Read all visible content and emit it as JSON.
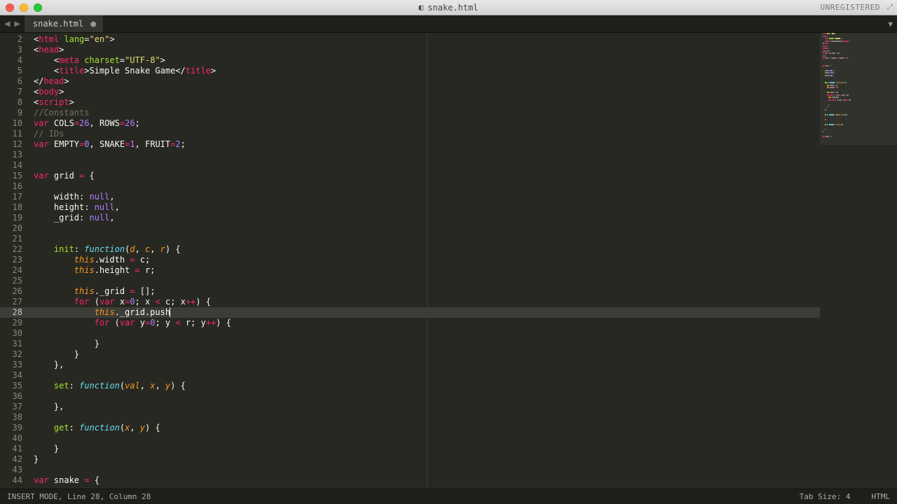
{
  "window": {
    "title": "snake.html",
    "unregistered": "UNREGISTERED"
  },
  "tabs": [
    {
      "label": "snake.html",
      "dirty": true
    }
  ],
  "gutter_start": 2,
  "gutter_end": 44,
  "active_line": 28,
  "status": {
    "left": "INSERT MODE, Line 28, Column 28",
    "tab_size": "Tab Size: 4",
    "syntax": "HTML"
  },
  "code_lines": [
    {
      "n": 2,
      "seg": [
        [
          "punc",
          "<"
        ],
        [
          "tag",
          "html"
        ],
        [
          "punc",
          " "
        ],
        [
          "attr",
          "lang"
        ],
        [
          "punc",
          "="
        ],
        [
          "str",
          "\"en\""
        ],
        [
          "punc",
          ">"
        ]
      ]
    },
    {
      "n": 3,
      "seg": [
        [
          "punc",
          "<"
        ],
        [
          "tag",
          "head"
        ],
        [
          "punc",
          ">"
        ]
      ]
    },
    {
      "n": 4,
      "seg": [
        [
          "punc",
          "    <"
        ],
        [
          "tag",
          "meta"
        ],
        [
          "punc",
          " "
        ],
        [
          "attr",
          "charset"
        ],
        [
          "punc",
          "="
        ],
        [
          "str",
          "\"UTF-8\""
        ],
        [
          "punc",
          ">"
        ]
      ]
    },
    {
      "n": 5,
      "seg": [
        [
          "punc",
          "    <"
        ],
        [
          "tag",
          "title"
        ],
        [
          "punc",
          ">"
        ],
        [
          "punc",
          "Simple Snake Game"
        ],
        [
          "punc",
          "</"
        ],
        [
          "tag",
          "title"
        ],
        [
          "punc",
          ">"
        ]
      ]
    },
    {
      "n": 6,
      "seg": [
        [
          "punc",
          "</"
        ],
        [
          "tag",
          "head"
        ],
        [
          "punc",
          ">"
        ]
      ]
    },
    {
      "n": 7,
      "seg": [
        [
          "punc",
          "<"
        ],
        [
          "tag",
          "body"
        ],
        [
          "punc",
          ">"
        ]
      ]
    },
    {
      "n": 8,
      "seg": [
        [
          "punc",
          "<"
        ],
        [
          "tag",
          "script"
        ],
        [
          "punc",
          ">"
        ]
      ]
    },
    {
      "n": 9,
      "seg": [
        [
          "cmt",
          "//Constants"
        ]
      ]
    },
    {
      "n": 10,
      "seg": [
        [
          "kw",
          "var"
        ],
        [
          "punc",
          " COLS"
        ],
        [
          "kw",
          "="
        ],
        [
          "num",
          "26"
        ],
        [
          "punc",
          ", ROWS"
        ],
        [
          "kw",
          "="
        ],
        [
          "num",
          "26"
        ],
        [
          "punc",
          ";"
        ]
      ]
    },
    {
      "n": 11,
      "seg": [
        [
          "cmt",
          "// IDs"
        ]
      ]
    },
    {
      "n": 12,
      "seg": [
        [
          "kw",
          "var"
        ],
        [
          "punc",
          " EMPTY"
        ],
        [
          "kw",
          "="
        ],
        [
          "num",
          "0"
        ],
        [
          "punc",
          ", SNAKE"
        ],
        [
          "kw",
          "="
        ],
        [
          "num",
          "1"
        ],
        [
          "punc",
          ", FRUIT"
        ],
        [
          "kw",
          "="
        ],
        [
          "num",
          "2"
        ],
        [
          "punc",
          ";"
        ]
      ]
    },
    {
      "n": 13,
      "seg": []
    },
    {
      "n": 14,
      "seg": []
    },
    {
      "n": 15,
      "seg": [
        [
          "kw",
          "var"
        ],
        [
          "punc",
          " grid "
        ],
        [
          "kw",
          "="
        ],
        [
          "punc",
          " {"
        ]
      ]
    },
    {
      "n": 16,
      "seg": []
    },
    {
      "n": 17,
      "seg": [
        [
          "punc",
          "    width: "
        ],
        [
          "const",
          "null"
        ],
        [
          "punc",
          ","
        ]
      ]
    },
    {
      "n": 18,
      "seg": [
        [
          "punc",
          "    height: "
        ],
        [
          "const",
          "null"
        ],
        [
          "punc",
          ","
        ]
      ]
    },
    {
      "n": 19,
      "seg": [
        [
          "punc",
          "    _grid: "
        ],
        [
          "const",
          "null"
        ],
        [
          "punc",
          ","
        ]
      ]
    },
    {
      "n": 20,
      "seg": []
    },
    {
      "n": 21,
      "seg": []
    },
    {
      "n": 22,
      "seg": [
        [
          "punc",
          "    "
        ],
        [
          "fn",
          "init"
        ],
        [
          "punc",
          ": "
        ],
        [
          "fnd",
          "function"
        ],
        [
          "punc",
          "("
        ],
        [
          "param",
          "d"
        ],
        [
          "punc",
          ", "
        ],
        [
          "param",
          "c"
        ],
        [
          "punc",
          ", "
        ],
        [
          "param",
          "r"
        ],
        [
          "punc",
          ") {"
        ]
      ]
    },
    {
      "n": 23,
      "seg": [
        [
          "punc",
          "        "
        ],
        [
          "this",
          "this"
        ],
        [
          "punc",
          ".width "
        ],
        [
          "kw",
          "="
        ],
        [
          "punc",
          " c;"
        ]
      ]
    },
    {
      "n": 24,
      "seg": [
        [
          "punc",
          "        "
        ],
        [
          "this",
          "this"
        ],
        [
          "punc",
          ".height "
        ],
        [
          "kw",
          "="
        ],
        [
          "punc",
          " r;"
        ]
      ]
    },
    {
      "n": 25,
      "seg": []
    },
    {
      "n": 26,
      "seg": [
        [
          "punc",
          "        "
        ],
        [
          "this",
          "this"
        ],
        [
          "punc",
          "._grid "
        ],
        [
          "kw",
          "="
        ],
        [
          "punc",
          " [];"
        ]
      ]
    },
    {
      "n": 27,
      "seg": [
        [
          "punc",
          "        "
        ],
        [
          "kw",
          "for"
        ],
        [
          "punc",
          " ("
        ],
        [
          "kw",
          "var"
        ],
        [
          "punc",
          " x"
        ],
        [
          "kw",
          "="
        ],
        [
          "num",
          "0"
        ],
        [
          "punc",
          "; x "
        ],
        [
          "kw",
          "<"
        ],
        [
          "punc",
          " c; x"
        ],
        [
          "kw",
          "++"
        ],
        [
          "punc",
          ") {"
        ]
      ]
    },
    {
      "n": 28,
      "seg": [
        [
          "punc",
          "            "
        ],
        [
          "this",
          "this"
        ],
        [
          "punc",
          "._grid.push"
        ]
      ],
      "active": true,
      "cursor": true
    },
    {
      "n": 29,
      "seg": [
        [
          "punc",
          "            "
        ],
        [
          "kw",
          "for"
        ],
        [
          "punc",
          " ("
        ],
        [
          "kw",
          "var"
        ],
        [
          "punc",
          " y"
        ],
        [
          "kw",
          "="
        ],
        [
          "num",
          "0"
        ],
        [
          "punc",
          "; y "
        ],
        [
          "kw",
          "<"
        ],
        [
          "punc",
          " r; y"
        ],
        [
          "kw",
          "++"
        ],
        [
          "punc",
          ") {"
        ]
      ]
    },
    {
      "n": 30,
      "seg": []
    },
    {
      "n": 31,
      "seg": [
        [
          "punc",
          "            }"
        ]
      ]
    },
    {
      "n": 32,
      "seg": [
        [
          "punc",
          "        }"
        ]
      ]
    },
    {
      "n": 33,
      "seg": [
        [
          "punc",
          "    },"
        ]
      ]
    },
    {
      "n": 34,
      "seg": []
    },
    {
      "n": 35,
      "seg": [
        [
          "punc",
          "    "
        ],
        [
          "fn",
          "set"
        ],
        [
          "punc",
          ": "
        ],
        [
          "fnd",
          "function"
        ],
        [
          "punc",
          "("
        ],
        [
          "param",
          "val"
        ],
        [
          "punc",
          ", "
        ],
        [
          "param",
          "x"
        ],
        [
          "punc",
          ", "
        ],
        [
          "param",
          "y"
        ],
        [
          "punc",
          ") {"
        ]
      ]
    },
    {
      "n": 36,
      "seg": []
    },
    {
      "n": 37,
      "seg": [
        [
          "punc",
          "    },"
        ]
      ]
    },
    {
      "n": 38,
      "seg": []
    },
    {
      "n": 39,
      "seg": [
        [
          "punc",
          "    "
        ],
        [
          "fn",
          "get"
        ],
        [
          "punc",
          ": "
        ],
        [
          "fnd",
          "function"
        ],
        [
          "punc",
          "("
        ],
        [
          "param",
          "x"
        ],
        [
          "punc",
          ", "
        ],
        [
          "param",
          "y"
        ],
        [
          "punc",
          ") {"
        ]
      ]
    },
    {
      "n": 40,
      "seg": []
    },
    {
      "n": 41,
      "seg": [
        [
          "punc",
          "    }"
        ]
      ]
    },
    {
      "n": 42,
      "seg": [
        [
          "punc",
          "}"
        ]
      ]
    },
    {
      "n": 43,
      "seg": []
    },
    {
      "n": 44,
      "seg": [
        [
          "kw",
          "var"
        ],
        [
          "punc",
          " snake "
        ],
        [
          "kw",
          "="
        ],
        [
          "punc",
          " {"
        ]
      ]
    }
  ],
  "minimap_colors": {
    "kw": "#f92672",
    "str": "#e6db74",
    "num": "#ae81ff",
    "const": "#ae81ff",
    "tag": "#f92672",
    "attr": "#a6e22e",
    "fn": "#a6e22e",
    "fnd": "#66d9ef",
    "param": "#fd971f",
    "cmt": "#75715e",
    "punc": "#8f8f80",
    "this": "#fd971f",
    "prop": "#66d9ef"
  }
}
